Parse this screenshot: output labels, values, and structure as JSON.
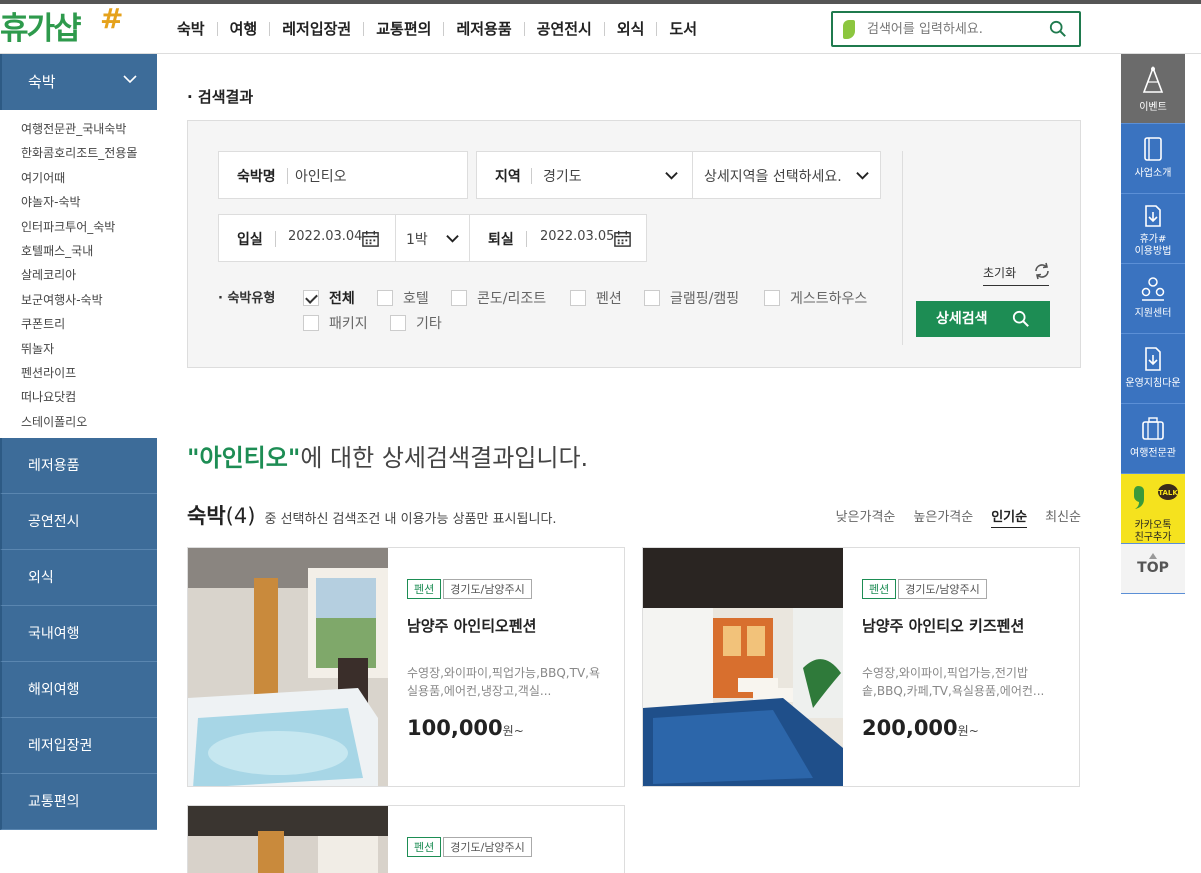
{
  "header": {
    "logo_text": "휴가샵",
    "logo_mark": "#",
    "nav": [
      "숙박",
      "여행",
      "레저입장권",
      "교통편의",
      "레저용품",
      "공연전시",
      "외식",
      "도서"
    ],
    "search_placeholder": "검색어를 입력하세요."
  },
  "sidebar": {
    "open_category": "숙박",
    "sub_items": [
      "여행전문관_국내숙박",
      "한화콤호리조트_전용몰",
      "여기어때",
      "야놀자-숙박",
      "인터파크투어_숙박",
      "호텔패스_국내",
      "살레코리아",
      "보군여행사-숙박",
      "쿠폰트리",
      "뛰놀자",
      "펜션라이프",
      "떠나요닷컴",
      "스테이폴리오"
    ],
    "categories": [
      "레저용품",
      "공연전시",
      "외식",
      "국내여행",
      "해외여행",
      "레저입장권",
      "교통편의"
    ]
  },
  "quick": {
    "event": "이벤트",
    "about": "사업소개",
    "guide_line1": "휴가#",
    "guide_line2": "이용방법",
    "support": "지원센터",
    "manual": "운영지침다운",
    "travel": "여행전문관",
    "kakao_line1": "카카오톡",
    "kakao_line2": "친구추가",
    "kakao_badge": "TALK",
    "top": "TOP"
  },
  "filter": {
    "section_title": "검색결과",
    "name_label": "숙박명",
    "name_value": "아인티오",
    "region_label": "지역",
    "region_value": "경기도",
    "detail_region": "상세지역을 선택하세요.",
    "checkin_label": "입실",
    "checkin_date": "2022.03.04",
    "nights": "1박",
    "checkout_label": "퇴실",
    "checkout_date": "2022.03.05",
    "type_label": "숙박유형",
    "types": [
      {
        "label": "전체",
        "checked": true
      },
      {
        "label": "호텔",
        "checked": false
      },
      {
        "label": "콘도/리조트",
        "checked": false
      },
      {
        "label": "펜션",
        "checked": false
      },
      {
        "label": "글램핑/캠핑",
        "checked": false
      },
      {
        "label": "게스트하우스",
        "checked": false
      },
      {
        "label": "패키지",
        "checked": false
      },
      {
        "label": "기타",
        "checked": false
      }
    ],
    "reset": "초기화",
    "search_button": "상세검색"
  },
  "results": {
    "query": "\"아인티오\"",
    "headline_suffix": "에 대한 상세검색결과입니다.",
    "category": "숙박",
    "count": "(4)",
    "count_desc": "중 선택하신 검색조건 내 이용가능 상품만 표시됩니다.",
    "sorts": [
      "낮은가격순",
      "높은가격순",
      "인기순",
      "최신순"
    ],
    "active_sort": "인기순",
    "cards": [
      {
        "type": "펜션",
        "area": "경기도/남양주시",
        "name": "남양주 아인티오펜션",
        "amenities": "수영장,와이파이,픽업가능,BBQ,TV,욕실용품,에어컨,냉장고,객실...",
        "price": "100,000",
        "unit": "원~"
      },
      {
        "type": "펜션",
        "area": "경기도/남양주시",
        "name": "남양주 아인티오 키즈펜션",
        "amenities": "수영장,와이파이,픽업가능,전기밥솥,BBQ,카페,TV,욕실용품,에어컨...",
        "price": "200,000",
        "unit": "원~"
      },
      {
        "type": "펜션",
        "area": "경기도/남양주시"
      }
    ]
  },
  "colors": {
    "brand_green": "#1d8d54",
    "sidebar_blue": "#3d6c99",
    "quick_blue": "#3a73c0",
    "kakao_yellow": "#f5e21e"
  }
}
